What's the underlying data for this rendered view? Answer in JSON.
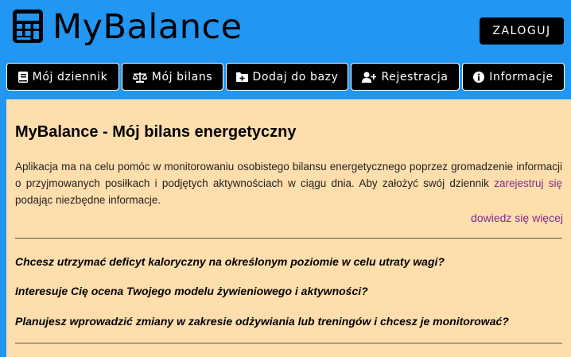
{
  "header": {
    "app_title": "MyBalance",
    "login_label": "ZALOGUJ",
    "logo_icon": "calculator-icon"
  },
  "nav": [
    {
      "label": "Mój dziennik",
      "icon": "book-icon"
    },
    {
      "label": "Mój bilans",
      "icon": "scale-icon"
    },
    {
      "label": "Dodaj do bazy",
      "icon": "folder-plus-icon"
    },
    {
      "label": "Rejestracja",
      "icon": "user-plus-icon"
    },
    {
      "label": "Informacje",
      "icon": "info-icon"
    }
  ],
  "main": {
    "heading": "MyBalance - Mój bilans energetyczny",
    "intro_text": "Aplikacja ma na celu pomóc w monitorowaniu osobistego bilansu energetycznego poprzez gromadzenie informacji o przyjmowanych posiłkach i podjętych aktywnościach w ciągu dnia. Aby założyć swój dziennik ",
    "register_link": "zarejestruj się",
    "intro_suffix": " podając niezbędne informacje.",
    "more_link": "dowiedz się więcej",
    "questions": [
      "Chcesz utrzymać deficyt kaloryczny na określonym poziomie w celu utraty wagi?",
      "Interesuje Cię ocena Twojego modelu żywieniowego i aktywności?",
      "Planujesz wprowadzić zmiany w zakresie odżywiania lub treningów i chcesz je monitorować?"
    ]
  },
  "colors": {
    "background": "#2196f3",
    "panel": "#ffdead",
    "button": "#000000",
    "link": "#7b2d8b"
  }
}
